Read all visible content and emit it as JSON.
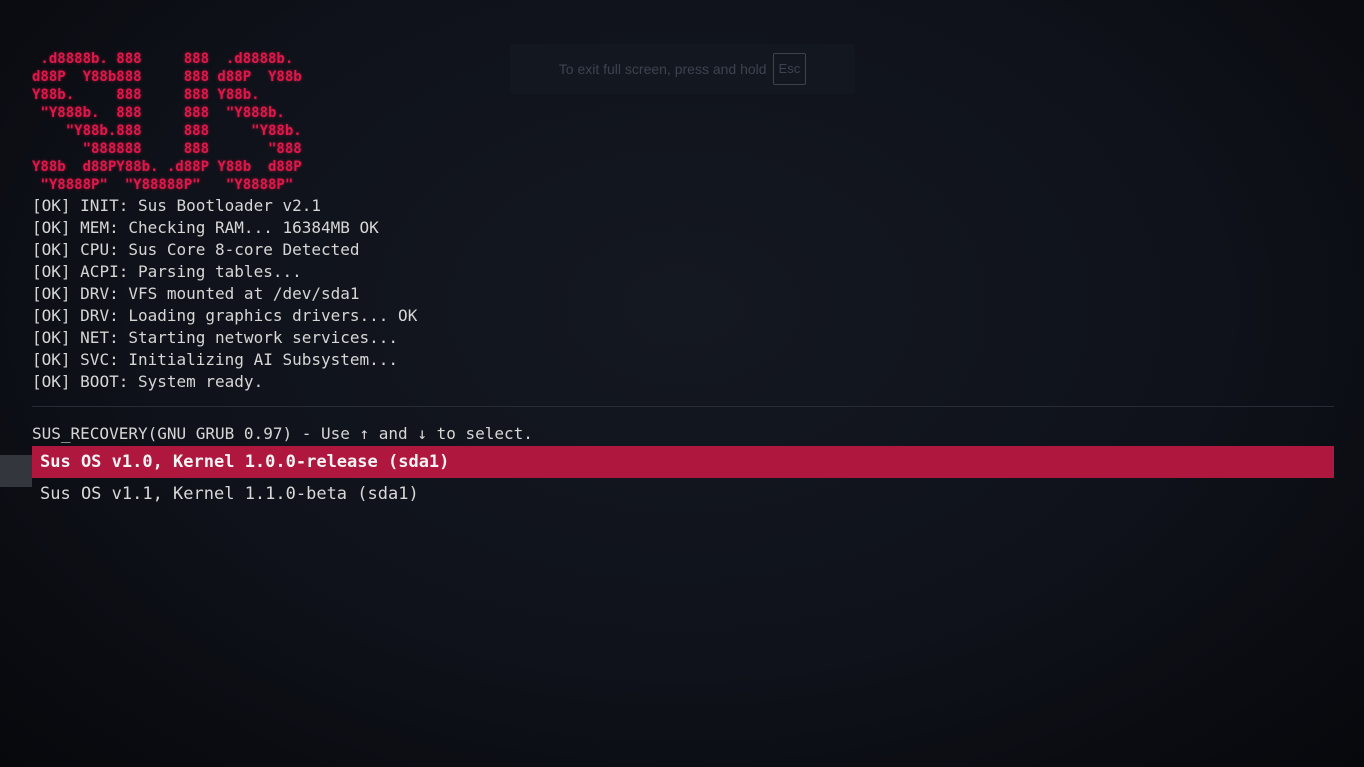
{
  "logo": {
    "lines": [
      " .d8888b. 888     888  .d8888b.",
      "d88P  Y88b888     888 d88P  Y88b",
      "Y88b.     888     888 Y88b.",
      " \"Y888b.  888     888  \"Y888b.",
      "    \"Y88b.888     888     \"Y88b.",
      "      \"888888     888       \"888",
      "Y88b  d88PY88b. .d88P Y88b  d88P",
      " \"Y8888P\"  \"Y88888P\"   \"Y8888P\""
    ]
  },
  "boot_log": [
    {
      "status": "[OK]",
      "message": "INIT: Sus Bootloader v2.1"
    },
    {
      "status": "[OK]",
      "message": "MEM: Checking RAM... 16384MB OK"
    },
    {
      "status": "[OK]",
      "message": "CPU: Sus Core 8-core Detected"
    },
    {
      "status": "[OK]",
      "message": "ACPI: Parsing tables..."
    },
    {
      "status": "[OK]",
      "message": "DRV: VFS mounted at /dev/sda1"
    },
    {
      "status": "[OK]",
      "message": "DRV: Loading graphics drivers... OK"
    },
    {
      "status": "[OK]",
      "message": "NET: Starting network services..."
    },
    {
      "status": "[OK]",
      "message": "SVC: Initializing AI Subsystem..."
    },
    {
      "status": "[OK]",
      "message": "BOOT: System ready."
    }
  ],
  "menu": {
    "header": "SUS_RECOVERY(GNU GRUB 0.97) - Use ↑ and ↓ to select.",
    "items": [
      {
        "label": "Sus OS v1.0, Kernel 1.0.0-release (sda1)",
        "selected": true
      },
      {
        "label": "Sus OS v1.1, Kernel 1.1.0-beta (sda1)",
        "selected": false
      }
    ]
  },
  "fullscreen_notice": {
    "text": "To exit full screen, press and hold",
    "key": "Esc"
  },
  "colors": {
    "background": "#0e1118",
    "logo": "#e0184a",
    "selection": "#b0173f",
    "text": "#d6d6d6"
  }
}
